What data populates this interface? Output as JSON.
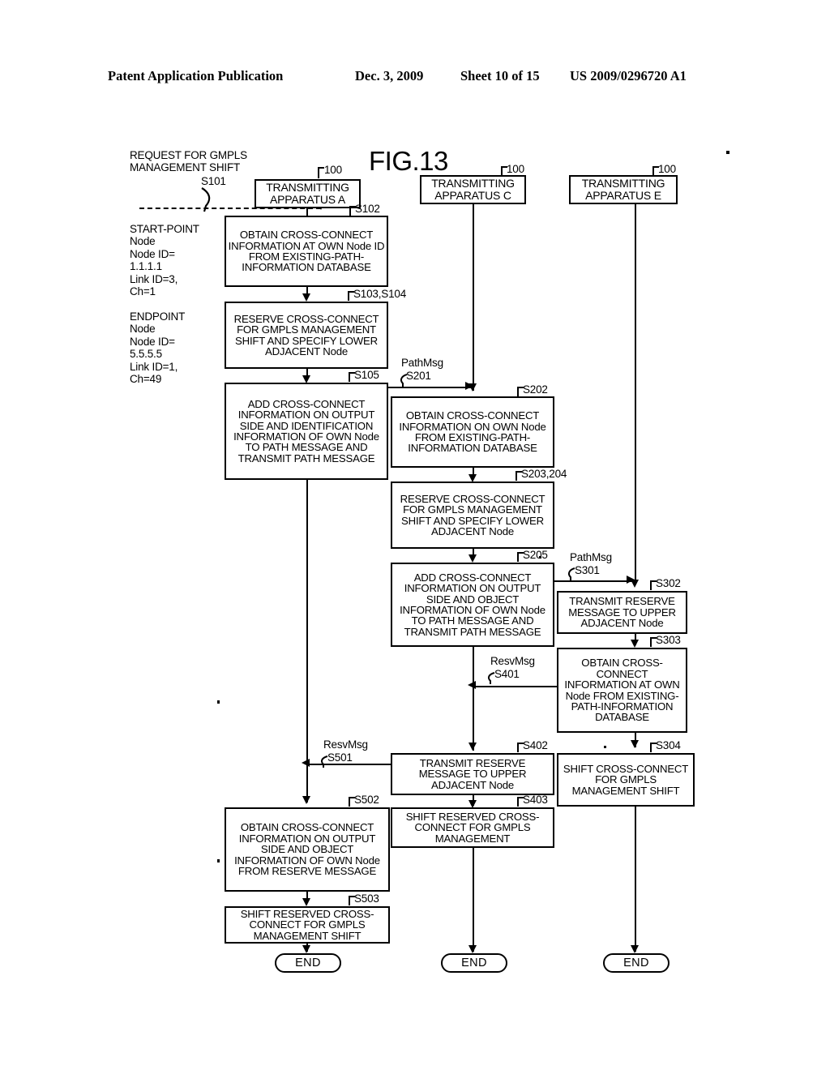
{
  "header": {
    "publication": "Patent Application Publication",
    "date": "Dec. 3, 2009",
    "sheet": "Sheet 10 of 15",
    "docnum": "US 2009/0296720 A1"
  },
  "figure": {
    "title": "FIG.13",
    "reference_numeral": "100"
  },
  "annotations": {
    "request": "REQUEST FOR GMPLS\nMANAGEMENT SHIFT",
    "request_step": "S101",
    "start_point": "START-POINT\nNode\nNode ID=\n1.1.1.1\nLink ID=3,\nCh=1",
    "endpoint": "ENDPOINT\nNode\nNode ID=\n5.5.5.5\nLink ID=1,\nCh=49"
  },
  "lanes": [
    {
      "id": "a",
      "title": "TRANSMITTING\nAPPARATUS A",
      "numeral": "100"
    },
    {
      "id": "c",
      "title": "TRANSMITTING\nAPPARATUS C",
      "numeral": "100"
    },
    {
      "id": "e",
      "title": "TRANSMITTING\nAPPARATUS E",
      "numeral": "100"
    }
  ],
  "steps": {
    "s102": {
      "ref": "S102",
      "text": "OBTAIN CROSS-CONNECT INFORMATION AT OWN Node ID FROM EXISTING-PATH-INFORMATION DATABASE"
    },
    "s103_104": {
      "ref": "S103,S104",
      "text": "RESERVE CROSS-CONNECT FOR GMPLS MANAGEMENT SHIFT AND SPECIFY LOWER ADJACENT Node"
    },
    "s105": {
      "ref": "S105",
      "text": "ADD CROSS-CONNECT INFORMATION ON OUTPUT SIDE AND IDENTIFICATION INFORMATION OF OWN Node TO PATH MESSAGE AND TRANSMIT PATH MESSAGE"
    },
    "s202": {
      "ref": "S202",
      "text": "OBTAIN CROSS-CONNECT INFORMATION ON OWN Node FROM EXISTING-PATH-INFORMATION DATABASE"
    },
    "s203_204": {
      "ref": "S203,204",
      "text": "RESERVE CROSS-CONNECT FOR GMPLS MANAGEMENT SHIFT AND SPECIFY LOWER ADJACENT Node"
    },
    "s205": {
      "ref": "S205",
      "text": "ADD CROSS-CONNECT INFORMATION ON OUTPUT SIDE AND OBJECT INFORMATION OF OWN Node TO PATH MESSAGE AND TRANSMIT PATH MESSAGE"
    },
    "s302": {
      "ref": "S302",
      "text": "TRANSMIT RESERVE MESSAGE TO UPPER ADJACENT Node"
    },
    "s303": {
      "ref": "S303",
      "text": "OBTAIN CROSS-CONNECT INFORMATION AT OWN Node FROM EXISTING-PATH-INFORMATION DATABASE"
    },
    "s304": {
      "ref": "S304",
      "text": "SHIFT CROSS-CONNECT FOR GMPLS MANAGEMENT SHIFT"
    },
    "s402": {
      "ref": "S402",
      "text": "TRANSMIT RESERVE MESSAGE TO UPPER ADJACENT Node"
    },
    "s403": {
      "ref": "S403",
      "text": "SHIFT RESERVED CROSS-CONNECT FOR GMPLS MANAGEMENT"
    },
    "s502": {
      "ref": "S502",
      "text": "OBTAIN CROSS-CONNECT INFORMATION ON OUTPUT SIDE AND OBJECT INFORMATION OF OWN Node FROM RESERVE MESSAGE"
    },
    "s503": {
      "ref": "S503",
      "text": "SHIFT RESERVED CROSS-CONNECT FOR GMPLS MANAGEMENT SHIFT"
    }
  },
  "messages": {
    "s201": {
      "label": "PathMsg",
      "ref": "S201"
    },
    "s301": {
      "label": "PathMsg",
      "ref": "S301"
    },
    "s401": {
      "label": "ResvMsg",
      "ref": "S401"
    },
    "s501": {
      "label": "ResvMsg",
      "ref": "S501"
    }
  },
  "terminators": {
    "end": "END"
  }
}
